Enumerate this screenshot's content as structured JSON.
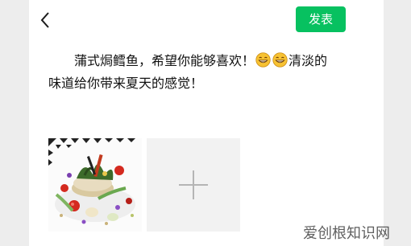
{
  "header": {
    "back_icon": "chevron-left-icon",
    "publish_label": "发表",
    "accent_color": "#07c160"
  },
  "post": {
    "text_part1": "蒲式焗鳕鱼，希望你能够喜欢！",
    "emoji_name": "grinning-face-icon",
    "text_part2": "清淡的味道给你带来夏天的感觉！"
  },
  "attachments": {
    "image_desc_name": "food-photo",
    "add_icon": "plus-icon"
  },
  "watermark": {
    "text": "爱创根知识网"
  }
}
